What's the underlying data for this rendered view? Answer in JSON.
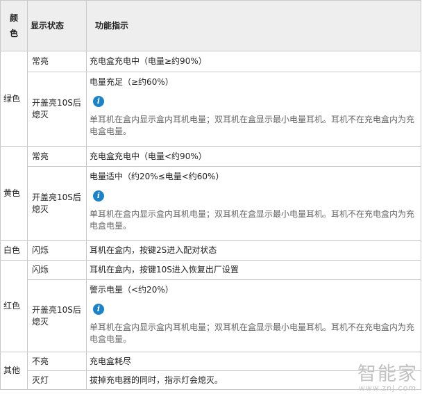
{
  "header": {
    "color": "颜色",
    "status": "显示状态",
    "function": "功能指示"
  },
  "groups": {
    "green": {
      "color": "绿色",
      "rows": [
        {
          "status": "常亮",
          "text": "充电盒充电中（电量≥约90%）"
        },
        {
          "status": "开盖亮10S后熄灭",
          "text": "电量充足（≥约60%）",
          "note": "单耳机在盒内显示盒内耳机电量；双耳机在盒显示最小电量耳机。耳机不在充电盒内为充电盒电量。"
        }
      ]
    },
    "yellow": {
      "color": "黄色",
      "rows": [
        {
          "status": "常亮",
          "text": "充电盒充电中（电量<约90%）"
        },
        {
          "status": "开盖亮10S后熄灭",
          "text": "电量适中（约20%≤电量<约60%）",
          "note": "单耳机在盒内显示盒内耳机电量；双耳机在盒显示最小电量耳机。耳机不在充电盒内为充电盒电量。"
        }
      ]
    },
    "white": {
      "color": "白色",
      "rows": [
        {
          "status": "闪烁",
          "text": "耳机在盒内，按键2S进入配对状态"
        }
      ]
    },
    "red": {
      "color": "红色",
      "rows": [
        {
          "status": "闪烁",
          "text": "耳机在盒内，按键10S进入恢复出厂设置"
        },
        {
          "status": "开盖亮10S后熄灭",
          "text": "警示电量（<约20%）",
          "note": "单耳机在盒内显示盒内耳机电量；双耳机在盒显示最小电量耳机。耳机不在充电盒内为充电盒电量。"
        }
      ]
    },
    "other": {
      "color": "其他",
      "rows": [
        {
          "status": "不亮",
          "text": "充电盒耗尽"
        },
        {
          "status": "灭灯",
          "text": "拔掉充电器的同时，指示灯会熄灭。"
        }
      ]
    }
  },
  "info_icon": {
    "name": "info-icon",
    "glyph": "i",
    "color": "#1a82c9"
  },
  "watermark": {
    "title": "智能家",
    "url": "www.znj.com"
  }
}
